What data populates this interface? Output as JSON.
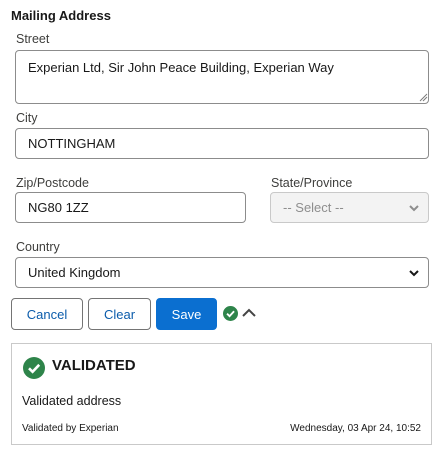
{
  "section": {
    "title": "Mailing Address"
  },
  "street": {
    "label": "Street",
    "value": "Experian Ltd, Sir John Peace Building, Experian Way"
  },
  "city": {
    "label": "City",
    "value": "NOTTINGHAM"
  },
  "zip": {
    "label": "Zip/Postcode",
    "value": "NG80 1ZZ"
  },
  "state": {
    "label": "State/Province",
    "selected": "-- Select --",
    "disabled": true
  },
  "country": {
    "label": "Country",
    "selected": "United Kingdom"
  },
  "actions": {
    "cancel": "Cancel",
    "clear": "Clear",
    "save": "Save"
  },
  "icons": {
    "status": "check-circle-icon",
    "collapse": "chevron-up-icon",
    "dropdown": "chevron-down-icon"
  },
  "validation": {
    "title": "VALIDATED",
    "message": "Validated address",
    "provider": "Validated by Experian",
    "timestamp": "Wednesday, 03 Apr 24, 10:52"
  },
  "colors": {
    "success": "#2e844a",
    "brand": "#0b6fd0",
    "link": "#0b5cab"
  }
}
